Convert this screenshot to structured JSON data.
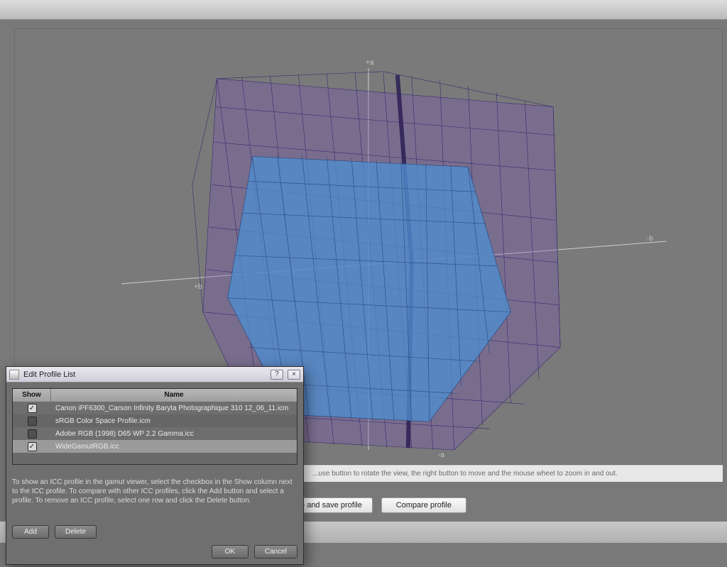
{
  "viewer": {
    "axis_plus_a": "+a",
    "axis_minus_a": "-a",
    "axis_plus_b": "+b",
    "axis_minus_b": "-b",
    "hint": "...use button to rotate the view, the right button to move and the mouse wheel to zoom in and out."
  },
  "buttons": {
    "create_save": "Create and save profile",
    "compare": "Compare profile"
  },
  "dialog": {
    "title": "Edit Profile List",
    "help_btn": "?",
    "close_btn": "×",
    "col_show": "Show",
    "col_name": "Name",
    "rows": [
      {
        "checked": true,
        "selected": false,
        "name": "Canon iPF6300_Carson Infinity Baryta Photographique 310 12_06_11.icm"
      },
      {
        "checked": false,
        "selected": false,
        "name": "sRGB Color Space Profile.icm"
      },
      {
        "checked": false,
        "selected": false,
        "name": "Adobe RGB (1998) D65 WP 2.2 Gamma.icc"
      },
      {
        "checked": true,
        "selected": true,
        "name": "WideGamutRGB.icc"
      }
    ],
    "help_text": "To show an ICC profile in the gamut viewer, select the checkbox in the Show column next to the ICC profile. To compare with other ICC profiles, click the Add button and select a profile. To remove an ICC profile, select one row and click the Delete button.",
    "add": "Add",
    "delete": "Delete",
    "ok": "OK",
    "cancel": "Cancel"
  },
  "colors": {
    "outer_gamut_stroke": "#3a2a6e",
    "outer_gamut_fill": "rgba(120,80,190,0.32)",
    "inner_gamut_stroke": "#2a4a80",
    "inner_gamut_fill": "rgba(70,130,200,0.78)"
  }
}
